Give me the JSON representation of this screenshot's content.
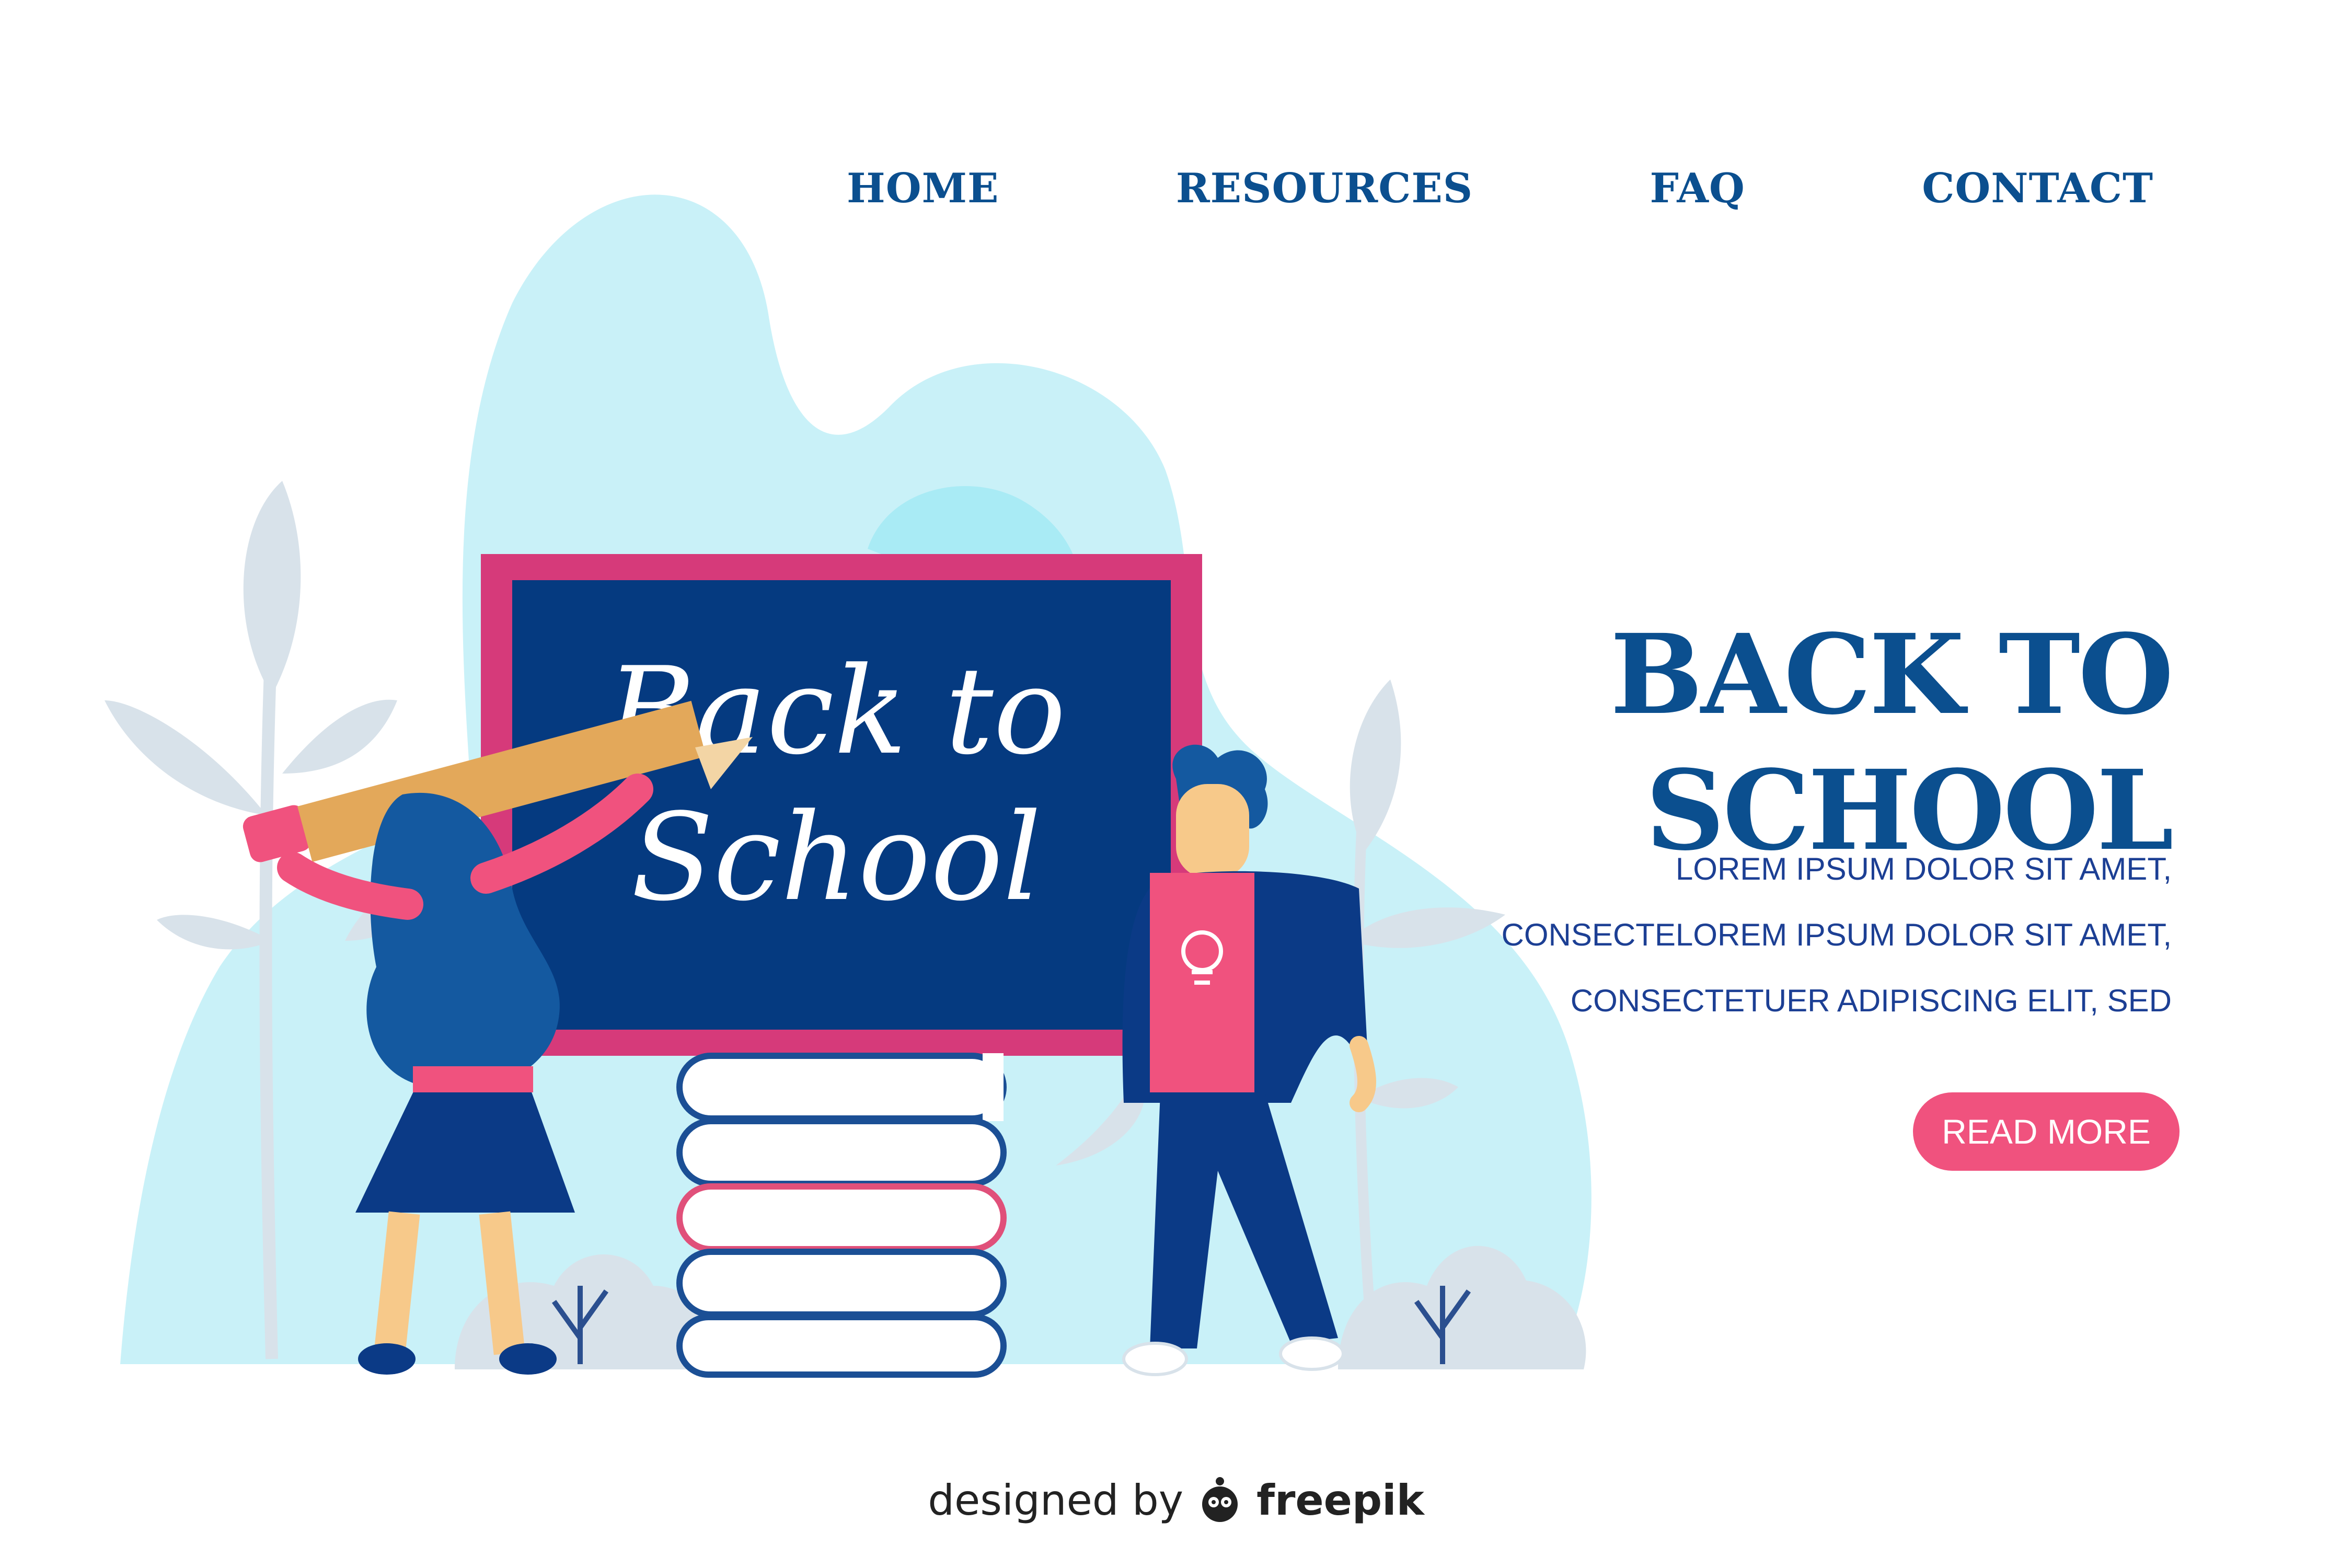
{
  "nav": {
    "items": [
      {
        "label": "HOME"
      },
      {
        "label": "RESOURCES"
      },
      {
        "label": "FAQ"
      },
      {
        "label": "CONTACT"
      }
    ]
  },
  "hero": {
    "title_line1": "BACK TO",
    "title_line2": "SCHOOL",
    "body_lines": [
      "LOREM IPSUM DOLOR SIT AMET,",
      "CONSECTELOREM IPSUM DOLOR SIT AMET,",
      "CONSECTETUER ADIPISCING ELIT, SED"
    ],
    "cta_label": "READ MORE"
  },
  "chalkboard": {
    "line1": "Back to",
    "line2": "School"
  },
  "footer": {
    "prefix": "designed by",
    "brand": "freepik"
  },
  "colors": {
    "navy": "#0b4f8f",
    "board": "#053a80",
    "board_frame": "#d63a7a",
    "pink": "#f0527e",
    "sky": "#c9f1f8",
    "leaf": "#d8e2ea"
  }
}
